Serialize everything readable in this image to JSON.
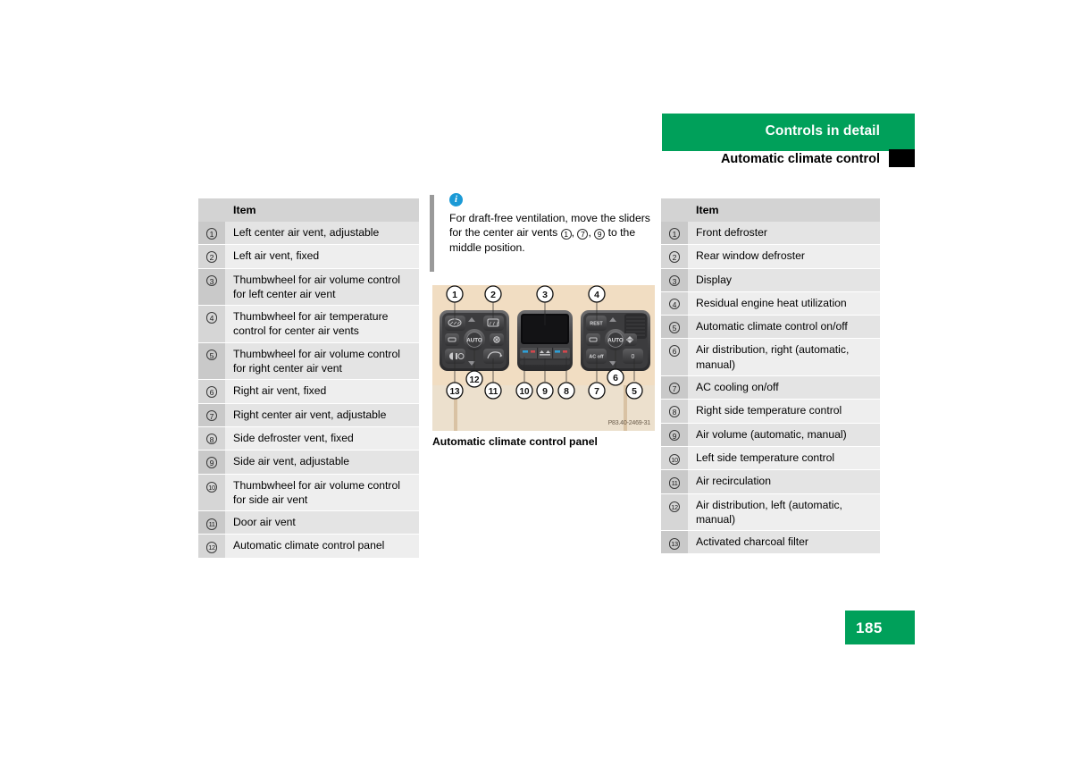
{
  "header": {
    "band_title": "Controls in detail",
    "subtitle": "Automatic climate control"
  },
  "page_number": "185",
  "left_table": {
    "header_label": "Item",
    "rows": [
      {
        "num": "1",
        "label": "Left center air vent, adjustable"
      },
      {
        "num": "2",
        "label": "Left air vent, fixed"
      },
      {
        "num": "3",
        "label": "Thumbwheel for air volume control for left center air vent"
      },
      {
        "num": "4",
        "label": "Thumbwheel for air temperature control for center air vents"
      },
      {
        "num": "5",
        "label": "Thumbwheel for air volume control for right center air vent"
      },
      {
        "num": "6",
        "label": "Right air vent, fixed"
      },
      {
        "num": "7",
        "label": "Right center air vent, adjustable"
      },
      {
        "num": "8",
        "label": "Side defroster vent, fixed"
      },
      {
        "num": "9",
        "label": "Side air vent, adjustable"
      },
      {
        "num": "10",
        "label": "Thumbwheel for air volume control for side air vent"
      },
      {
        "num": "11",
        "label": "Door air vent"
      },
      {
        "num": "12",
        "label": "Automatic climate control panel"
      }
    ]
  },
  "right_table": {
    "header_label": "Item",
    "rows": [
      {
        "num": "1",
        "label": "Front defroster"
      },
      {
        "num": "2",
        "label": "Rear window defroster"
      },
      {
        "num": "3",
        "label": "Display"
      },
      {
        "num": "4",
        "label": "Residual engine heat utilization"
      },
      {
        "num": "5",
        "label": "Automatic climate control on/off"
      },
      {
        "num": "6",
        "label": "Air distribution, right (automatic, manual)"
      },
      {
        "num": "7",
        "label": "AC cooling on/off"
      },
      {
        "num": "8",
        "label": "Right side temperature control"
      },
      {
        "num": "9",
        "label": "Air volume (automatic, manual)"
      },
      {
        "num": "10",
        "label": "Left side temperature control"
      },
      {
        "num": "11",
        "label": "Air recirculation"
      },
      {
        "num": "12",
        "label": "Air distribution, left (automatic, manual)"
      },
      {
        "num": "13",
        "label": "Activated charcoal filter"
      }
    ]
  },
  "note": {
    "icon": "info-icon",
    "text_part1": "For draft-free ventilation, move the sliders for the center air vents ",
    "ref1": "1",
    "sep1": ", ",
    "ref2": "7",
    "sep2": ", ",
    "ref3": "9",
    "text_part2": " to the middle position."
  },
  "figure": {
    "caption": "Automatic climate control panel",
    "credit": "P83.40-2469-31",
    "background_color": "#f1ddc2",
    "callouts_top": [
      "1",
      "2",
      "3",
      "4"
    ],
    "callouts_bottom": [
      "13",
      "12",
      "11",
      "10",
      "9",
      "8",
      "7",
      "6",
      "5"
    ],
    "left_cluster_labels": [
      "AUTO"
    ],
    "right_cluster_labels": [
      "REST",
      "AUTO",
      "AC off"
    ]
  },
  "colors": {
    "brand_green": "#00a05a",
    "info_blue": "#1b9ad6",
    "table_row": "#e4e4e4",
    "table_row_alt": "#eeeeee",
    "table_header": "#d3d3d3"
  }
}
